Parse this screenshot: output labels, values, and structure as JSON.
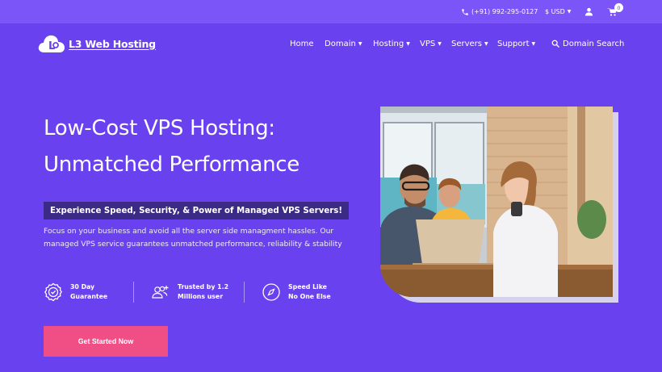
{
  "topbar": {
    "phone": "(+91) 992-295-0127",
    "currency": "$ USD",
    "cart_count": "0",
    "icons": [
      "phone-icon",
      "user-icon",
      "cart-icon"
    ]
  },
  "brand": {
    "name": "L3 Web Hosting"
  },
  "nav": {
    "items": [
      {
        "label": "Home"
      },
      {
        "label": "Domain"
      },
      {
        "label": "Hosting"
      },
      {
        "label": "VPS"
      },
      {
        "label": "Servers"
      },
      {
        "label": "Support"
      }
    ],
    "search_label": "Domain Search"
  },
  "hero": {
    "title_line1": "Low-Cost VPS Hosting:",
    "title_line2": "Unmatched Performance",
    "tagline": "Experience Speed, Security, & Power of Managed VPS Servers!",
    "description": "Focus on your business and avoid all the server side managment hassles. Our managed VPS service guarantees unmatched performance, reliability & stability",
    "features": [
      {
        "line1": "30 Day",
        "line2": "Guarantee",
        "icon": "badge-check-icon"
      },
      {
        "line1": "Trusted by 1.2",
        "line2": "Millions user",
        "icon": "add-users-icon"
      },
      {
        "line1": "Speed Like",
        "line2": "No One Else",
        "icon": "compass-icon"
      }
    ],
    "cta_label": "Get Started Now"
  },
  "colors": {
    "background": "#6a41ee",
    "topbar": "#7b55f7",
    "tagline_bg": "#3b2a86",
    "cta": "#f04f86"
  }
}
